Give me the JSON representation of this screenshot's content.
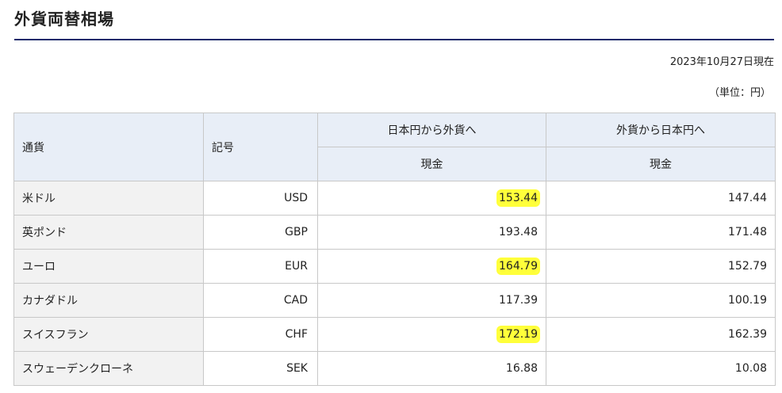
{
  "page": {
    "title": "外貨両替相場",
    "date": "2023年10月27日現在",
    "unit": "（単位：円）"
  },
  "table": {
    "headers": {
      "currency": "通貨",
      "symbol": "記号",
      "yen_to_foreign": "日本円から外貨へ",
      "foreign_to_yen": "外貨から日本円へ",
      "cash_a": "現金",
      "cash_b": "現金"
    },
    "rows": [
      {
        "name": "米ドル",
        "code": "USD",
        "buy": "153.44",
        "sell": "147.44",
        "buy_highlighted": true
      },
      {
        "name": "英ポンド",
        "code": "GBP",
        "buy": "193.48",
        "sell": "171.48",
        "buy_highlighted": false
      },
      {
        "name": "ユーロ",
        "code": "EUR",
        "buy": "164.79",
        "sell": "152.79",
        "buy_highlighted": true
      },
      {
        "name": "カナダドル",
        "code": "CAD",
        "buy": "117.39",
        "sell": "100.19",
        "buy_highlighted": false
      },
      {
        "name": "スイスフラン",
        "code": "CHF",
        "buy": "172.19",
        "sell": "162.39",
        "buy_highlighted": true
      },
      {
        "name": "スウェーデンクローネ",
        "code": "SEK",
        "buy": "16.88",
        "sell": "10.08",
        "buy_highlighted": false
      }
    ]
  },
  "colors": {
    "header_bg": "#e8eef7",
    "name_cell_bg": "#f2f2f2",
    "highlight": "#ffff3a",
    "title_rule": "#1b2a6b"
  }
}
